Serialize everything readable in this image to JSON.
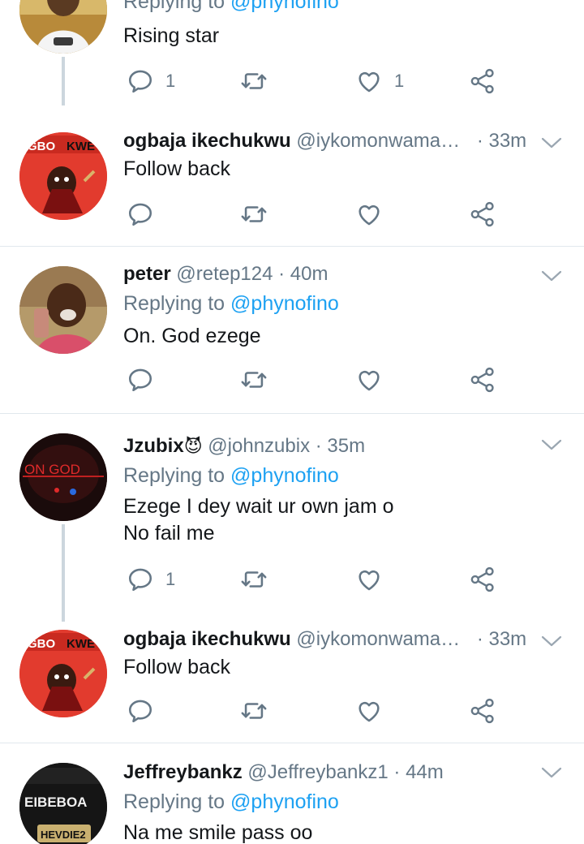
{
  "colors": {
    "accent": "#1da1f2",
    "muted": "#657786",
    "text": "#14171a",
    "line": "#ccd6dd"
  },
  "tweets": [
    {
      "replying_prefix": "Replying to",
      "replying_mention": "@phynofino",
      "text": "Rising star",
      "replies": "1",
      "likes": "1",
      "avatar": "boy-photo"
    },
    {
      "name": "ogbaja ikechukwu",
      "handle": "@iykomonwama…",
      "time": "· 33m",
      "text": "Follow back",
      "avatar_label": "GBO",
      "avatar_label2": "KWE"
    },
    {
      "name": "peter",
      "handle": "@retep124",
      "time": "· 40m",
      "replying_prefix": "Replying to",
      "replying_mention": "@phynofino",
      "text": "On. God ezege"
    },
    {
      "name": "Jzubix",
      "emoji": "😈",
      "handle": "@johnzubix",
      "time": "· 35m",
      "replying_prefix": "Replying to",
      "replying_mention": "@phynofino",
      "text_line1": "Ezege I dey wait ur own jam o",
      "text_line2": "No fail me",
      "replies": "1",
      "avatar_label": "ON GOD"
    },
    {
      "name": "ogbaja ikechukwu",
      "handle": "@iykomonwama…",
      "time": "· 33m",
      "text": "Follow back",
      "avatar_label": "GBO",
      "avatar_label2": "KWE"
    },
    {
      "name": "Jeffreybankz",
      "handle": "@Jeffreybankz1",
      "time": "· 44m",
      "replying_prefix": "Replying to",
      "replying_mention": "@phynofino",
      "text": "Na me smile pass oo",
      "avatar_label": "EIBEBOA",
      "avatar_label2": "HEVDIE2"
    }
  ]
}
